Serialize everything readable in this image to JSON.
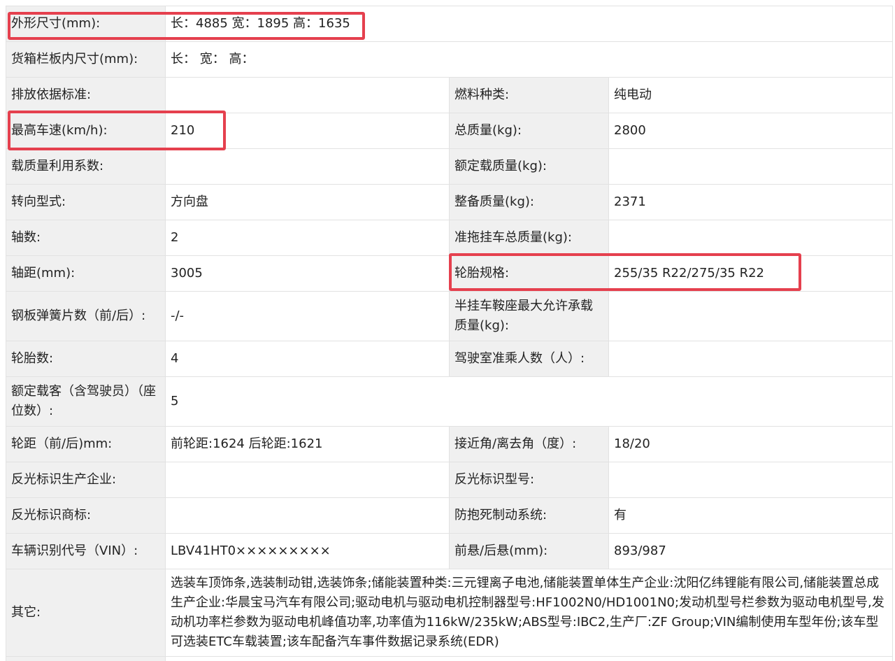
{
  "rows": {
    "dimensions": {
      "label": "外形尺寸(mm):",
      "value": "长：4885 宽：1895 高：1635"
    },
    "cargo_box": {
      "label": "货箱栏板内尺寸(mm):",
      "value": "长：  宽：  高："
    },
    "emission_standard": {
      "label": "排放依据标准:",
      "value": ""
    },
    "fuel_type": {
      "label": "燃料种类:",
      "value": "纯电动"
    },
    "max_speed": {
      "label": "最高车速(km/h):",
      "value": "210"
    },
    "gross_mass": {
      "label": "总质量(kg):",
      "value": "2800"
    },
    "load_coefficient": {
      "label": "载质量利用系数:",
      "value": ""
    },
    "rated_load": {
      "label": "额定载质量(kg):",
      "value": ""
    },
    "steering": {
      "label": "转向型式:",
      "value": "方向盘"
    },
    "curb_mass": {
      "label": "整备质量(kg):",
      "value": "2371"
    },
    "axles": {
      "label": "轴数:",
      "value": "2"
    },
    "trailer_mass": {
      "label": "准拖挂车总质量(kg):",
      "value": ""
    },
    "wheelbase": {
      "label": "轴距(mm):",
      "value": "3005"
    },
    "tire_spec": {
      "label": "轮胎规格:",
      "value": "255/35 R22/275/35 R22"
    },
    "leaf_springs": {
      "label": "钢板弹簧片数（前/后）:",
      "value": "-/-"
    },
    "saddle_load": {
      "label": "半挂车鞍座最大允许承载质量(kg):",
      "value": ""
    },
    "tire_count": {
      "label": "轮胎数:",
      "value": "4"
    },
    "cab_occupants": {
      "label": "驾驶室准乘人数（人）:",
      "value": ""
    },
    "rated_passengers": {
      "label": "额定载客（含驾驶员）（座位数）:",
      "value": "5"
    },
    "track": {
      "label": "轮距（前/后)mm:",
      "value": "前轮距:1624 后轮距:1621"
    },
    "angles": {
      "label": "接近角/离去角（度）:",
      "value": "18/20"
    },
    "reflector_maker": {
      "label": "反光标识生产企业:",
      "value": ""
    },
    "reflector_model": {
      "label": "反光标识型号:",
      "value": ""
    },
    "reflector_brand": {
      "label": "反光标识商标:",
      "value": ""
    },
    "abs": {
      "label": "防抱死制动系统:",
      "value": "有"
    },
    "vin": {
      "label": "车辆识别代号（VIN）:",
      "value": "LBV41HT0×××××××××"
    },
    "overhang": {
      "label": "前悬/后悬(mm):",
      "value": "893/987"
    },
    "other": {
      "label": "其它:",
      "value": "选装车顶饰条,选装制动钳,选装饰条;储能装置种类:三元锂离子电池,储能装置单体生产企业:沈阳亿纬锂能有限公司,储能装置总成生产企业:华晨宝马汽车有限公司;驱动电机与驱动电机控制器型号:HF1002N0/HD1001N0;发动机型号栏参数为驱动电机型号,发动机功率栏参数为驱动电机峰值功率,功率值为116kW/235kW;ABS型号:IBC2,生产厂:ZF Group;VIN编制使用车型年份;该车型可选装ETC车载装置;该车配备汽车事件数据记录系统(EDR)"
    }
  },
  "colors": {
    "label_bg": "#f0f0f0",
    "border": "#e2e2e2",
    "highlight": "#e5404e"
  }
}
